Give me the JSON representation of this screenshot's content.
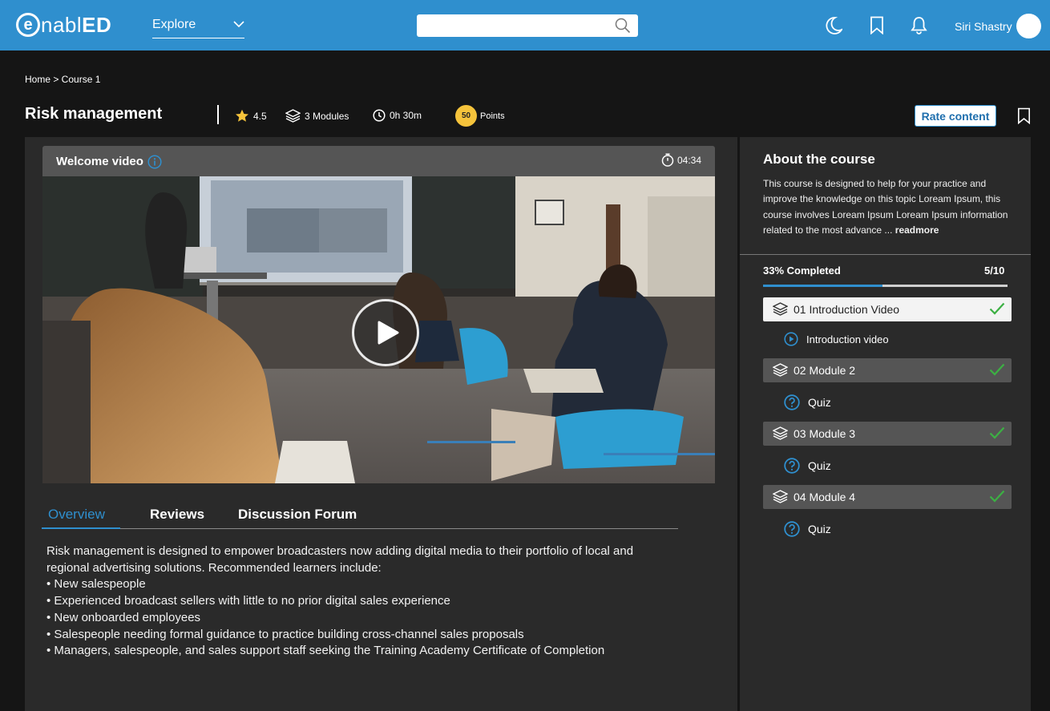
{
  "header": {
    "logo_mark": "e",
    "logo_light": "nabl",
    "logo_bold": "ED",
    "explore_label": "Explore",
    "search_placeholder": "",
    "user_name": "Siri Shastry"
  },
  "breadcrumb": "Home > Course 1",
  "course": {
    "title": "Risk management",
    "rating": "4.5",
    "modules": "3 Modules",
    "duration": "0h 30m",
    "points_value": "50",
    "points_label": "Points",
    "rate_button": "Rate content"
  },
  "video": {
    "title": "Welcome video",
    "duration": "04:34"
  },
  "tabs": [
    {
      "label": "Overview",
      "active": true
    },
    {
      "label": "Reviews",
      "active": false
    },
    {
      "label": "Discussion Forum",
      "active": false
    }
  ],
  "overview": {
    "intro": "Risk management is designed to empower broadcasters now adding digital media to their portfolio of local and regional advertising solutions. Recommended learners include:",
    "bullets": [
      "• New salespeople",
      "• Experienced broadcast sellers with little to no prior digital sales experience",
      "• New onboarded employees",
      "• Salespeople needing formal guidance to practice building cross-channel sales proposals",
      "• Managers, salespeople, and sales support staff seeking the Training Academy Certificate of Completion"
    ]
  },
  "about": {
    "title": "About the course",
    "description": "This course is designed to help for your practice and improve the knowledge on this topic Loream Ipsum, this course involves Loream Ipsum Loream Ipsum information related to the most advance ...",
    "readmore": "readmore"
  },
  "progress": {
    "label": "33% Completed",
    "count": "5/10",
    "fraction": 0.49
  },
  "curriculum": [
    {
      "label": "01  Introduction Video",
      "sub": "Introduction video",
      "sub_icon": "play-circle-icon",
      "active": true
    },
    {
      "label": "02  Module 2",
      "sub": "Quiz",
      "sub_icon": "question-circle-icon",
      "active": false
    },
    {
      "label": "03  Module 3",
      "sub": "Quiz",
      "sub_icon": "question-circle-icon",
      "active": false
    },
    {
      "label": "04  Module 4",
      "sub": "Quiz",
      "sub_icon": "question-circle-icon",
      "active": false
    }
  ],
  "colors": {
    "header": "#2f8fce",
    "accent": "#2f8fce",
    "check": "#3cb043",
    "points": "#f5c33b"
  },
  "icons": [
    "moon-icon",
    "bookmark-icon",
    "bell-icon",
    "search-icon",
    "star-icon",
    "layers-icon",
    "clock-icon",
    "info-icon",
    "stopwatch-icon",
    "play-icon",
    "check-icon"
  ]
}
